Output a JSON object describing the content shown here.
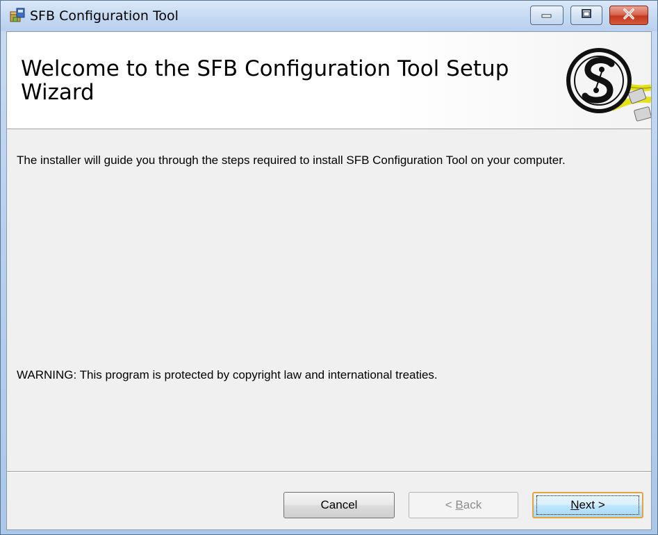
{
  "window": {
    "title": "SFB Configuration Tool"
  },
  "banner": {
    "title": "Welcome to the SFB Configuration Tool Setup Wizard"
  },
  "content": {
    "intro": "The installer will guide you through the steps required to install SFB Configuration Tool on your computer.",
    "warning": "WARNING: This  program is protected by copyright law and international treaties."
  },
  "buttons": {
    "cancel": "Cancel",
    "back_prefix": "< ",
    "back_access": "B",
    "back_rest": "ack",
    "next_access": "N",
    "next_rest": "ext >"
  },
  "colors": {
    "focus_border": "#e8a23a",
    "cable_yellow": "#e6e21a",
    "close_red": "#c5381f"
  },
  "icons": {
    "app": "installer-package-icon",
    "logo": "sfb-logo-network-cable"
  }
}
